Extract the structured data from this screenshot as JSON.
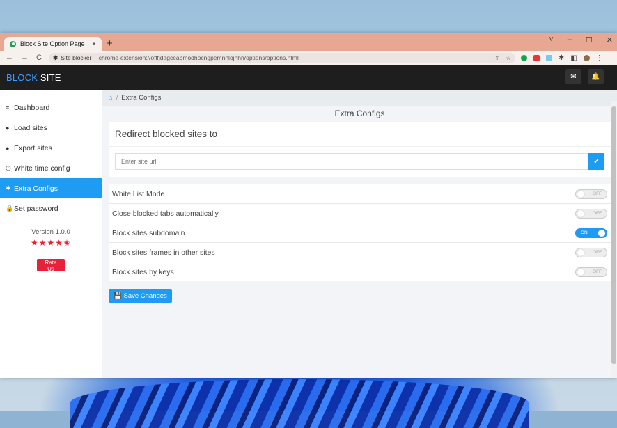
{
  "browser": {
    "tab_title": "Block Site Option Page",
    "tab_close": "×",
    "new_tab": "+",
    "window_controls": [
      "˅",
      "–",
      "☐",
      "✕"
    ],
    "nav": {
      "back": "←",
      "forward": "→",
      "reload": "C"
    },
    "address_chip": "Site blocker",
    "address_url": "chrome-extension://offfjdagceabmodhpcngpemnnlojnhn/options/options.html"
  },
  "app": {
    "brand_part1": "BLOCK",
    "brand_part2": " SITE",
    "mail_icon": "✉",
    "bell_icon": "🔔"
  },
  "sidebar": {
    "items": [
      {
        "icon": "≡",
        "label": "Dashboard"
      },
      {
        "icon": "●",
        "label": "Load sites"
      },
      {
        "icon": "●",
        "label": "Export sites"
      },
      {
        "icon": "◷",
        "label": "White time config"
      },
      {
        "icon": "✱",
        "label": "Extra Configs",
        "active": true
      },
      {
        "icon": "🔒",
        "label": "Set password"
      }
    ],
    "version": "Version 1.0.0",
    "stars": "★★★★✬",
    "rating": 4.5,
    "rate_button": "Rate Us"
  },
  "main": {
    "breadcrumb_current": "Extra Configs",
    "page_title": "Extra Configs",
    "redirect": {
      "heading": "Redirect blocked sites to",
      "placeholder": "Enter site url",
      "submit_icon": "✔"
    },
    "options": [
      {
        "label": "White List Mode",
        "state": "OFF"
      },
      {
        "label": "Close blocked tabs automatically",
        "state": "OFF"
      },
      {
        "label": "Block sites subdomain",
        "state": "ON"
      },
      {
        "label": "Block sites frames in other sites",
        "state": "OFF"
      },
      {
        "label": "Block sites by keys",
        "state": "OFF"
      }
    ],
    "save_label": "Save Changes"
  },
  "colors": {
    "accent": "#1e9bf3",
    "danger": "#e8203a",
    "appbar": "#1e1e1e",
    "tabstrip": "#e6a893"
  }
}
